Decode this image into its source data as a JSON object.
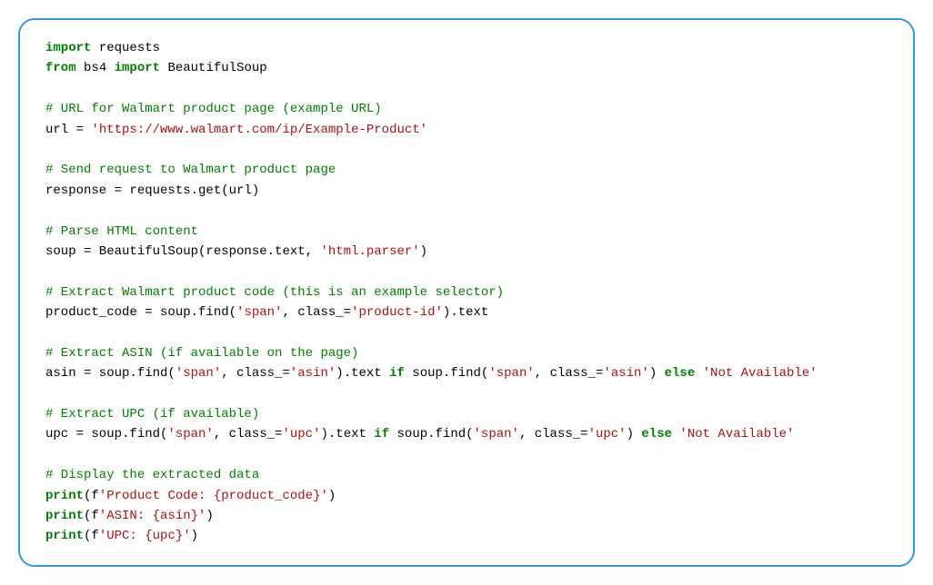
{
  "code": {
    "l1a": "import",
    "l1b": " requests",
    "l2a": "from",
    "l2b": " bs4 ",
    "l2c": "import",
    "l2d": " BeautifulSoup",
    "l3": "",
    "l4": "# URL for Walmart product page (example URL)",
    "l5a": "url = ",
    "l5b": "'https://www.walmart.com/ip/Example-Product'",
    "l6": "",
    "l7": "# Send request to Walmart product page",
    "l8": "response = requests.get(url)",
    "l9": "",
    "l10": "# Parse HTML content",
    "l11a": "soup = BeautifulSoup(response.text, ",
    "l11b": "'html.parser'",
    "l11c": ")",
    "l12": "",
    "l13": "# Extract Walmart product code (this is an example selector)",
    "l14a": "product_code = soup.find(",
    "l14b": "'span'",
    "l14c": ", class_=",
    "l14d": "'product-id'",
    "l14e": ").text",
    "l15": "",
    "l16": "# Extract ASIN (if available on the page)",
    "l17a": "asin = soup.find(",
    "l17b": "'span'",
    "l17c": ", class_=",
    "l17d": "'asin'",
    "l17e": ").text ",
    "l17f": "if",
    "l17g": " soup.find(",
    "l17h": "'span'",
    "l17i": ", class_=",
    "l17j": "'asin'",
    "l17k": ") ",
    "l17l": "else",
    "l17m": " ",
    "l17n": "'Not Available'",
    "l18": "",
    "l19": "# Extract UPC (if available)",
    "l20a": "upc = soup.find(",
    "l20b": "'span'",
    "l20c": ", class_=",
    "l20d": "'upc'",
    "l20e": ").text ",
    "l20f": "if",
    "l20g": " soup.find(",
    "l20h": "'span'",
    "l20i": ", class_=",
    "l20j": "'upc'",
    "l20k": ") ",
    "l20l": "else",
    "l20m": " ",
    "l20n": "'Not Available'",
    "l21": "",
    "l22": "# Display the extracted data",
    "l23a": "print",
    "l23b": "(f",
    "l23c": "'Product Code: {product_code}'",
    "l23d": ")",
    "l24a": "print",
    "l24b": "(f",
    "l24c": "'ASIN: {asin}'",
    "l24d": ")",
    "l25a": "print",
    "l25b": "(f",
    "l25c": "'UPC: {upc}'",
    "l25d": ")"
  }
}
